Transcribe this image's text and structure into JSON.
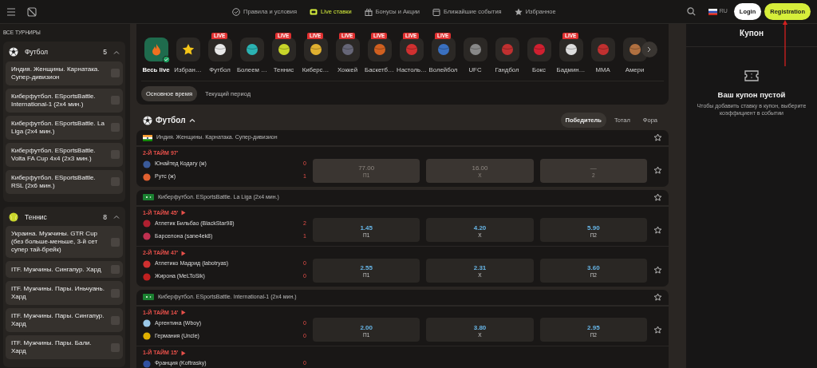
{
  "top_nav": [
    {
      "label": "Правила и условия",
      "kind": "rules",
      "selected": false
    },
    {
      "label": "Live ставки",
      "kind": "live",
      "selected": true
    },
    {
      "label": "Бонусы и Акции",
      "kind": "gift",
      "selected": false
    },
    {
      "label": "Ближайшие события",
      "kind": "calendar",
      "selected": false
    },
    {
      "label": "Избранное",
      "kind": "star",
      "selected": false
    }
  ],
  "language": "RU",
  "login_button": "Login",
  "registration_button": "Registration",
  "sidebar": {
    "title": "ВСЕ ТУРНИРЫ",
    "groups": [
      {
        "name": "Футбол",
        "kind": "football",
        "count": "5",
        "expanded": true,
        "items": [
          {
            "label": "Индия. Женщины. Карнатака. Супер-дивизион",
            "checked": false
          },
          {
            "label": "Киберфутбол. ESportsBattle. International-1 (2x4 мин.)",
            "checked": false
          },
          {
            "label": "Киберфутбол. ESportsBattle. La Liga (2x4 мин.)",
            "checked": false
          },
          {
            "label": "Киберфутбол. ESportsBattle. Volta FA Cup 4x4 (2x3 мин.)",
            "checked": false
          },
          {
            "label": "Киберфутбол. ESportsBattle. RSL (2x6 мин.)",
            "checked": false
          }
        ]
      },
      {
        "name": "Теннис",
        "kind": "tennis",
        "count": "8",
        "expanded": true,
        "items": [
          {
            "label": "Украина. Мужчины. GTR Cup (без больше-меньше, 3-й сет супер тай-брейк)",
            "checked": false
          },
          {
            "label": "ITF. Мужчины. Сингапур. Хард",
            "checked": false
          },
          {
            "label": "ITF. Мужчины. Пары. Иньчуань. Хард",
            "checked": false
          },
          {
            "label": "ITF. Мужчины. Пары. Сингапур. Хард",
            "checked": false
          },
          {
            "label": "ITF. Мужчины. Пары. Бали. Хард",
            "checked": false
          }
        ]
      }
    ]
  },
  "sports": [
    {
      "label": "Весь live",
      "kind": "all",
      "selected": true
    },
    {
      "label": "Избран…",
      "kind": "favorites",
      "selected": false
    },
    {
      "label": "Футбол",
      "kind": "sport",
      "badge": "LIVE",
      "selected": false
    },
    {
      "label": "Болеем …",
      "kind": "sport",
      "selected": false
    },
    {
      "label": "Теннис",
      "kind": "sport",
      "badge": "LIVE",
      "selected": false
    },
    {
      "label": "Киберс…",
      "kind": "sport",
      "badge": "LIVE",
      "selected": false
    },
    {
      "label": "Хоккей",
      "kind": "sport",
      "badge": "LIVE",
      "selected": false
    },
    {
      "label": "Баскетб…",
      "kind": "sport",
      "badge": "LIVE",
      "selected": false
    },
    {
      "label": "Настоль…",
      "kind": "sport",
      "badge": "LIVE",
      "selected": false
    },
    {
      "label": "Волейбол",
      "kind": "sport",
      "badge": "LIVE",
      "selected": false
    },
    {
      "label": "UFC",
      "kind": "sport",
      "selected": false
    },
    {
      "label": "Гандбол",
      "kind": "sport",
      "selected": false
    },
    {
      "label": "Бокс",
      "kind": "sport",
      "selected": false
    },
    {
      "label": "Бадмин…",
      "kind": "sport",
      "badge": "LIVE",
      "selected": false
    },
    {
      "label": "MMA",
      "kind": "sport",
      "selected": false
    },
    {
      "label": "Амери",
      "kind": "sport",
      "selected": false
    }
  ],
  "time_tabs": [
    {
      "label": "Основное время",
      "selected": true
    },
    {
      "label": "Текущий период",
      "selected": false
    }
  ],
  "section": {
    "title": "Футбол",
    "expanded": true,
    "market_tabs": [
      {
        "label": "Победитель",
        "selected": true
      },
      {
        "label": "Тотал",
        "selected": false
      },
      {
        "label": "Фора",
        "selected": false
      }
    ]
  },
  "leagues": [
    {
      "name": "Индия. Женщины. Карнатака. Супер-дивизион",
      "matches": [
        {
          "period": "2-Й ТАЙМ 97'",
          "video": false,
          "suspended": true,
          "teams": [
            {
              "name": "Юнайтед Кодагу (ж)",
              "score": "0"
            },
            {
              "name": "Рутс (ж)",
              "score": "1"
            }
          ],
          "odds": [
            {
              "value": "77.00",
              "label": "П1"
            },
            {
              "value": "16.00",
              "label": "X"
            },
            {
              "value": "—",
              "label": "2"
            }
          ]
        }
      ]
    },
    {
      "name": "Киберфутбол. ESportsBattle. La Liga (2x4 мин.)",
      "matches": [
        {
          "period": "1-Й ТАЙМ 45'",
          "video": true,
          "suspended": false,
          "teams": [
            {
              "name": "Атлетик Бильбао (BlackStar98)",
              "score": "2"
            },
            {
              "name": "Барселона (sane4ek8)",
              "score": "1"
            }
          ],
          "odds": [
            {
              "value": "1.45",
              "label": "П1"
            },
            {
              "value": "4.20",
              "label": "X"
            },
            {
              "value": "5.90",
              "label": "П2"
            }
          ]
        },
        {
          "period": "2-Й ТАЙМ 47'",
          "video": true,
          "suspended": false,
          "teams": [
            {
              "name": "Атлетико Мадрид (labotryas)",
              "score": "0"
            },
            {
              "name": "Жирона (MeLToSik)",
              "score": "0"
            }
          ],
          "odds": [
            {
              "value": "2.55",
              "label": "П1"
            },
            {
              "value": "2.31",
              "label": "X"
            },
            {
              "value": "3.60",
              "label": "П2"
            }
          ]
        }
      ]
    },
    {
      "name": "Киберфутбол. ESportsBattle. International-1 (2x4 мин.)",
      "matches": [
        {
          "period": "1-Й ТАЙМ 14'",
          "video": true,
          "suspended": false,
          "teams": [
            {
              "name": "Аргентина (Wboy)",
              "score": "0"
            },
            {
              "name": "Германия (Uncle)",
              "score": "0"
            }
          ],
          "odds": [
            {
              "value": "2.00",
              "label": "П1"
            },
            {
              "value": "3.80",
              "label": "X"
            },
            {
              "value": "2.95",
              "label": "П2"
            }
          ]
        },
        {
          "period": "1-Й ТАЙМ 15'",
          "video": true,
          "teams": [
            {
              "name": "Франция (Koftrasky)",
              "score": "0"
            }
          ]
        }
      ]
    }
  ],
  "coupon": {
    "title": "Купон",
    "empty_title": "Ваш купон пустой",
    "empty_text": "Чтобы добавить ставку в купон, выберите коэффициент в событии"
  }
}
